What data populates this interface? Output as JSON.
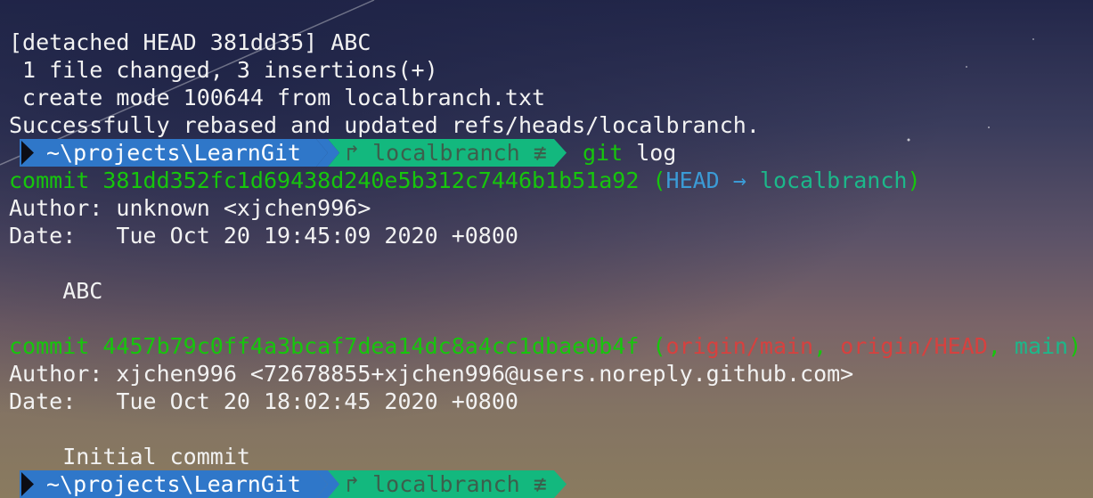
{
  "colors": {
    "path_segment": "#2f77c9",
    "branch_segment": "#13b87e",
    "commit_hash": "#16c60c",
    "head_ref": "#3b9bd6",
    "local_branch_ref": "#1cb88a",
    "remote_ref": "#d6413f"
  },
  "output": {
    "line1": "[detached HEAD 381dd35] ABC",
    "line2": " 1 file changed, 3 insertions(+)",
    "line3": " create mode 100644 from localbranch.txt",
    "line4": "Successfully rebased and updated refs/heads/localbranch."
  },
  "prompt1": {
    "path": "~\\projects\\LearnGit",
    "branch_icon": "branch-arrow-icon",
    "branch": "↱ localbranch ≢",
    "command": "git log"
  },
  "commits": [
    {
      "label": "commit ",
      "hash": "381dd352fc1d69438d240e5b312c7446b1b51a92",
      "refs_open": " (",
      "ref_head": "HEAD → ",
      "ref_local": "localbranch",
      "refs_close": ")",
      "author": "Author: unknown <xjchen996>",
      "date": "Date:   Tue Oct 20 19:45:09 2020 +0800",
      "message": "    ABC"
    },
    {
      "label": "commit ",
      "hash": "4457b79c0ff4a3bcaf7dea14dc8a4cc1dbae0b4f",
      "refs_open": " (",
      "ref_remote1": "origin/main",
      "sep1": ", ",
      "ref_remote2": "origin/HEAD",
      "sep2": ", ",
      "ref_main": "main",
      "refs_close": ")",
      "author": "Author: xjchen996 <72678855+xjchen996@users.noreply.github.com>",
      "date": "Date:   Tue Oct 20 18:02:45 2020 +0800",
      "message": "    Initial commit"
    }
  ],
  "prompt2": {
    "path": "~\\projects\\LearnGit",
    "branch": "↱ localbranch ≢"
  }
}
